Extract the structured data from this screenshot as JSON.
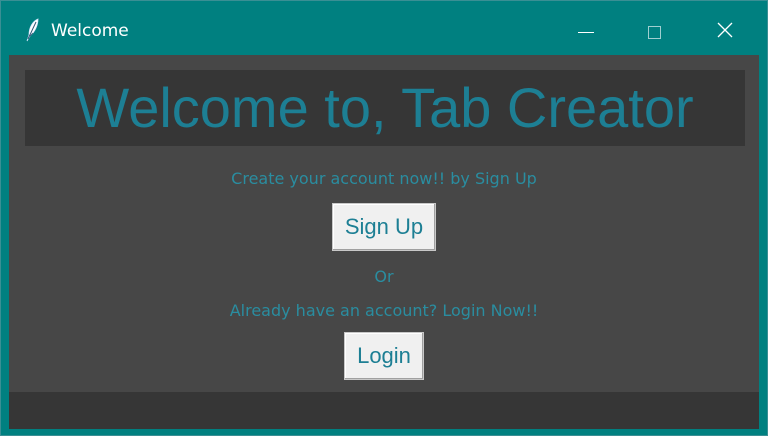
{
  "window": {
    "title": "Welcome",
    "controls": {
      "minimize": "minimize",
      "maximize": "maximize",
      "close": "close"
    }
  },
  "content": {
    "heading": "Welcome to, Tab Creator",
    "signup_prompt": "Create your account now!! by Sign Up",
    "signup_button": "Sign Up",
    "or_text": "Or",
    "login_prompt": "Already have an account? Login Now!!",
    "login_button": "Login"
  },
  "colors": {
    "titlebar": "#008080",
    "background": "#474747",
    "banner": "#363636",
    "accent_text": "#1d7f94",
    "button": "#f0f0f0"
  },
  "icons": {
    "app": "feather-icon",
    "minimize": "minimize-icon",
    "maximize": "maximize-icon",
    "close": "close-icon"
  }
}
